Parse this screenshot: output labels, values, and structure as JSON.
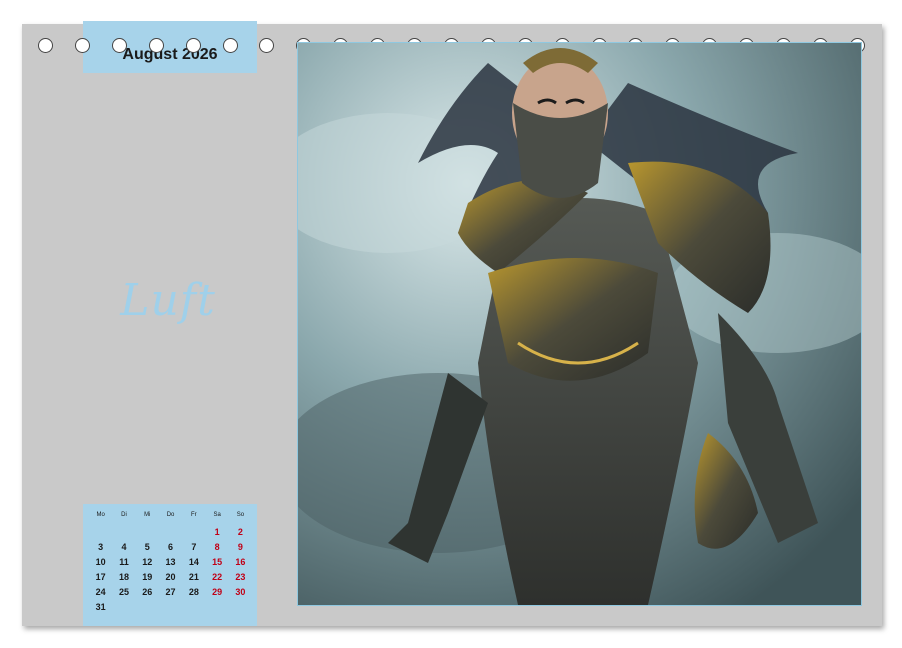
{
  "calendar": {
    "month_label": "August 2026",
    "title": "Luft",
    "weekdays": [
      "Mo",
      "Di",
      "Mi",
      "Do",
      "Fr",
      "Sa",
      "So"
    ],
    "weeks": [
      [
        "",
        "",
        "",
        "",
        "",
        "1",
        "2"
      ],
      [
        "3",
        "4",
        "5",
        "6",
        "7",
        "8",
        "9"
      ],
      [
        "10",
        "11",
        "12",
        "13",
        "14",
        "15",
        "16"
      ],
      [
        "17",
        "18",
        "19",
        "20",
        "21",
        "22",
        "23"
      ],
      [
        "24",
        "25",
        "26",
        "27",
        "28",
        "29",
        "30"
      ],
      [
        "31",
        "",
        "",
        "",
        "",
        "",
        ""
      ]
    ]
  },
  "colors": {
    "accent": "#a7d3ea",
    "page": "#c9c9c9",
    "weekend": "#c00016"
  },
  "image": {
    "subject": "armored-woman-warrior-illustration"
  }
}
